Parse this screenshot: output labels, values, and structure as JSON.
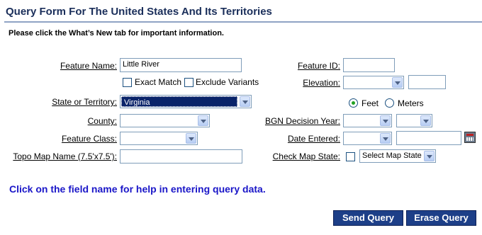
{
  "title": "Query Form For The United States And Its Territories",
  "notice": "Please click the What’s New tab for important information.",
  "fields": {
    "feature_name": {
      "label": "Feature Name:",
      "value": "Little River"
    },
    "exact_match": {
      "label": "Exact Match"
    },
    "exclude_variants": {
      "label": "Exclude Variants"
    },
    "state": {
      "label": "State or Territory:",
      "value": "Virginia"
    },
    "county": {
      "label": "County:",
      "value": ""
    },
    "feature_class": {
      "label": "Feature Class:",
      "value": ""
    },
    "topo_map": {
      "label": "Topo Map Name (7.5'x7.5'):",
      "value": ""
    },
    "feature_id": {
      "label": "Feature ID:",
      "value": ""
    },
    "elevation": {
      "label": "Elevation:",
      "value": ""
    },
    "units": {
      "feet": "Feet",
      "meters": "Meters",
      "selected": "Feet"
    },
    "bgn_year": {
      "label": "BGN Decision Year:"
    },
    "date_entered": {
      "label": "Date Entered:"
    },
    "map_state": {
      "label": "Check Map State:",
      "select_value": "Select Map State"
    }
  },
  "help_text": "Click on the field name for help in entering query data.",
  "buttons": {
    "send": "Send Query",
    "erase": "Erase Query"
  },
  "colors": {
    "accent": "#1d3f88",
    "title": "#1a2e5a",
    "help": "#1a16c8"
  }
}
